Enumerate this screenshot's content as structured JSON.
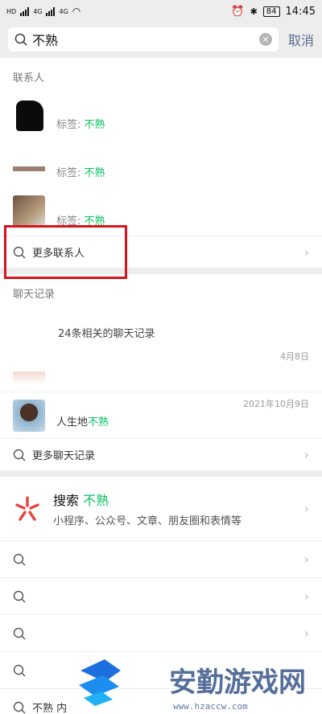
{
  "status": {
    "left": "HD",
    "net1": "4G",
    "net2": "4G",
    "battery": "84",
    "time": "14:45"
  },
  "search": {
    "value": "不熟",
    "cancel": "取消"
  },
  "contacts": {
    "title": "联系人",
    "tag_prefix": "标签: ",
    "items": [
      {
        "tag": "不熟"
      },
      {
        "tag": "不熟"
      },
      {
        "tag": "不熟"
      }
    ],
    "more": "更多联系人"
  },
  "chats": {
    "title": "聊天记录",
    "summary": "24条相关的聊天记录",
    "items": [
      {
        "date": "4月8日",
        "text": ""
      },
      {
        "date": "2021年10月9日",
        "text_prefix": "人生地",
        "text_hl": "不熟"
      }
    ],
    "more": "更多聊天记录"
  },
  "web": {
    "title_prefix": "搜索 ",
    "title_hl": "不熟",
    "subtitle": "小程序、公众号、文章、朋友圈和表情等"
  },
  "suggestions": [
    {
      "text": ""
    },
    {
      "text": ""
    },
    {
      "text": ""
    },
    {
      "text": ""
    },
    {
      "text": "不熟 内"
    }
  ],
  "watermark": {
    "text": "安勤游戏网",
    "url": "www.hzaccw.com"
  },
  "colors": {
    "accent": "#07c160",
    "link": "#576b95",
    "highlight_box": "#d8121a",
    "web_icon": "#e64340"
  }
}
